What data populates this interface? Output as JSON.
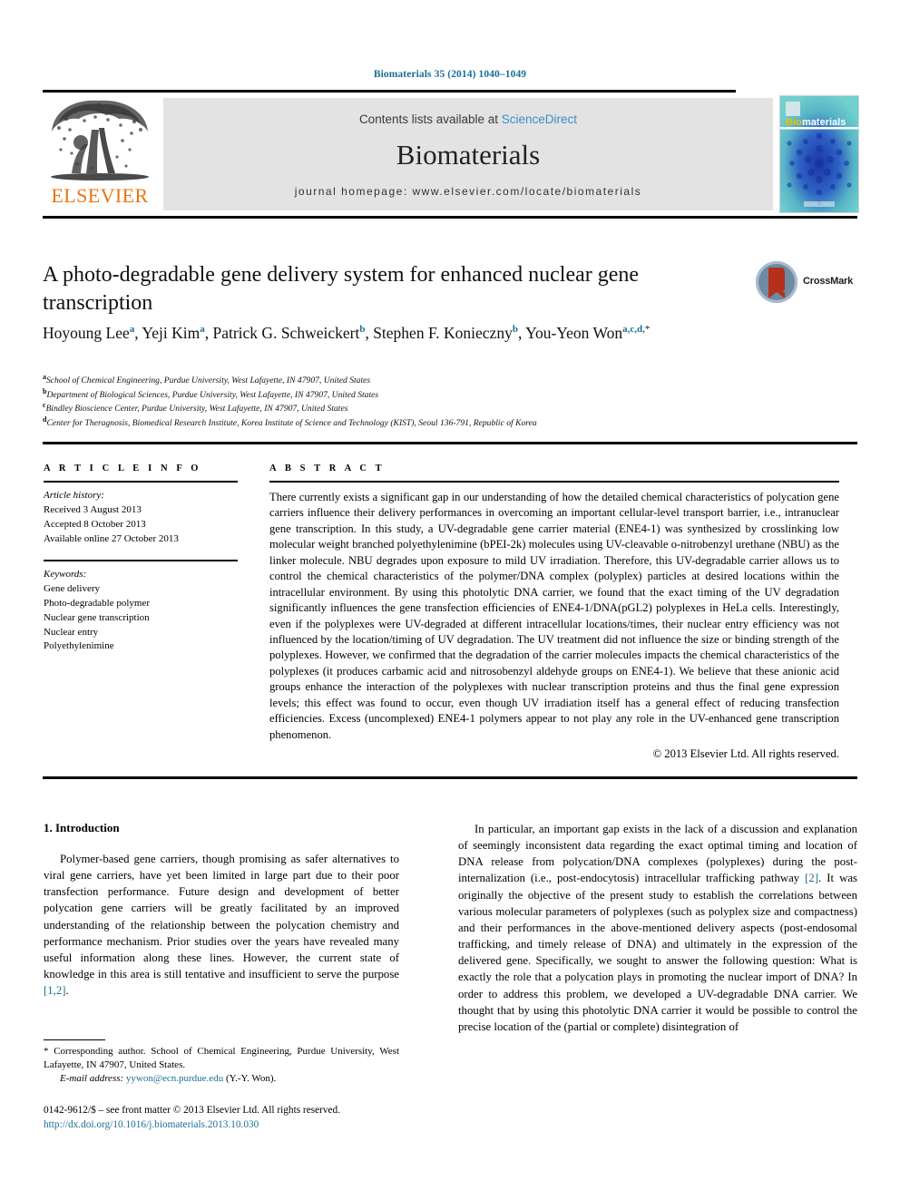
{
  "running_head": "Biomaterials 35 (2014) 1040–1049",
  "masthead": {
    "contents_prefix": "Contents lists available at ",
    "science_direct": "ScienceDirect",
    "journal_title": "Biomaterials",
    "homepage": "journal homepage: www.elsevier.com/locate/biomaterials",
    "publisher_wordmark": "ELSEVIER",
    "cover_title_bio": "Bio",
    "cover_title_materials": "materials",
    "colors": {
      "accent_teal": "#1a6e96",
      "science_direct_blue": "#3a8fc8",
      "elsevier_orange": "#e87511",
      "panel_gray": "#e3e3e3",
      "cover_teal": "#5ec3c8",
      "cover_blue": "#1f3f9e"
    }
  },
  "article": {
    "title": "A photo-degradable gene delivery system for enhanced nuclear gene transcription",
    "crossmark_label": "CrossMark",
    "authors_line1": "Hoyoung Lee",
    "authors": [
      {
        "name": "Hoyoung Lee",
        "marks": "a",
        "sep": ", "
      },
      {
        "name": "Yeji Kim",
        "marks": "a",
        "sep": ", "
      },
      {
        "name": "Patrick G. Schweickert",
        "marks": "b",
        "sep": ", "
      },
      {
        "name": "Stephen F. Konieczny",
        "marks": "b",
        "sep": ", "
      },
      {
        "name": "You-Yeon Won",
        "marks": "a,c,d,",
        "sep": ""
      }
    ],
    "affiliations": [
      {
        "mark": "a",
        "text": "School of Chemical Engineering, Purdue University, West Lafayette, IN 47907, United States"
      },
      {
        "mark": "b",
        "text": "Department of Biological Sciences, Purdue University, West Lafayette, IN 47907, United States"
      },
      {
        "mark": "c",
        "text": "Bindley Bioscience Center, Purdue University, West Lafayette, IN 47907, United States"
      },
      {
        "mark": "d",
        "text": "Center for Theragnosis, Biomedical Research Institute, Korea Institute of Science and Technology (KIST), Seoul 136-791, Republic of Korea"
      }
    ]
  },
  "article_info": {
    "heading": "A R T I C L E   I N F O",
    "history_label": "Article history:",
    "history": [
      "Received 3 August 2013",
      "Accepted 8 October 2013",
      "Available online 27 October 2013"
    ],
    "keywords_label": "Keywords:",
    "keywords": [
      "Gene delivery",
      "Photo-degradable polymer",
      "Nuclear gene transcription",
      "Nuclear entry",
      "Polyethylenimine"
    ]
  },
  "abstract": {
    "heading": "A B S T R A C T",
    "text": "There currently exists a significant gap in our understanding of how the detailed chemical characteristics of polycation gene carriers influence their delivery performances in overcoming an important cellular-level transport barrier, i.e., intranuclear gene transcription. In this study, a UV-degradable gene carrier material (ENE4-1) was synthesized by crosslinking low molecular weight branched polyethylenimine (bPEI-2k) molecules using UV-cleavable o-nitrobenzyl urethane (NBU) as the linker molecule. NBU degrades upon exposure to mild UV irradiation. Therefore, this UV-degradable carrier allows us to control the chemical characteristics of the polymer/DNA complex (polyplex) particles at desired locations within the intracellular environment. By using this photolytic DNA carrier, we found that the exact timing of the UV degradation significantly influences the gene transfection efficiencies of ENE4-1/DNA(pGL2) polyplexes in HeLa cells. Interestingly, even if the polyplexes were UV-degraded at different intracellular locations/times, their nuclear entry efficiency was not influenced by the location/timing of UV degradation. The UV treatment did not influence the size or binding strength of the polyplexes. However, we confirmed that the degradation of the carrier molecules impacts the chemical characteristics of the polyplexes (it produces carbamic acid and nitrosobenzyl aldehyde groups on ENE4-1). We believe that these anionic acid groups enhance the interaction of the polyplexes with nuclear transcription proteins and thus the final gene expression levels; this effect was found to occur, even though UV irradiation itself has a general effect of reducing transfection efficiencies. Excess (uncomplexed) ENE4-1 polymers appear to not play any role in the UV-enhanced gene transcription phenomenon.",
    "copyright": "© 2013 Elsevier Ltd. All rights reserved."
  },
  "introduction": {
    "heading": "1. Introduction",
    "left_paragraph_part1": "Polymer-based gene carriers, though promising as safer alternatives to viral gene carriers, have yet been limited in large part due to their poor transfection performance. Future design and development of better polycation gene carriers will be greatly facilitated by an improved understanding of the relationship between the polycation chemistry and performance mechanism. Prior studies over the years have revealed many useful information along these lines. However, the current state of knowledge in this area is still tentative and insufficient to serve the purpose ",
    "left_paragraph_ref": "[1,2]",
    "left_paragraph_part2": ".",
    "right_paragraph_part1": "In particular, an important gap exists in the lack of a discussion and explanation of seemingly inconsistent data regarding the exact optimal timing and location of DNA release from polycation/DNA complexes (polyplexes) during the post-internalization (i.e., post-endocytosis) intracellular trafficking pathway ",
    "right_paragraph_ref": "[2]",
    "right_paragraph_part2": ". It was originally the objective of the present study to establish the correlations between various molecular parameters of polyplexes (such as polyplex size and compactness) and their performances in the above-mentioned delivery aspects (post-endosomal trafficking, and timely release of DNA) and ultimately in the expression of the delivered gene. Specifically, we sought to answer the following question: What is exactly the role that a polycation plays in promoting the nuclear import of DNA? In order to address this problem, we developed a UV-degradable DNA carrier. We thought that by using this photolytic DNA carrier it would be possible to control the precise location of the (partial or complete) disintegration of"
  },
  "footnote": {
    "corresponding": "* Corresponding author. School of Chemical Engineering, Purdue University, West Lafayette, IN 47907, United States.",
    "email_label": "E-mail address:",
    "email": "yywon@ecn.purdue.edu",
    "email_suffix": "(Y.-Y. Won)."
  },
  "imprint": {
    "issn_line": "0142-9612/$ – see front matter © 2013 Elsevier Ltd. All rights reserved.",
    "doi": "http://dx.doi.org/10.1016/j.biomaterials.2013.10.030"
  }
}
